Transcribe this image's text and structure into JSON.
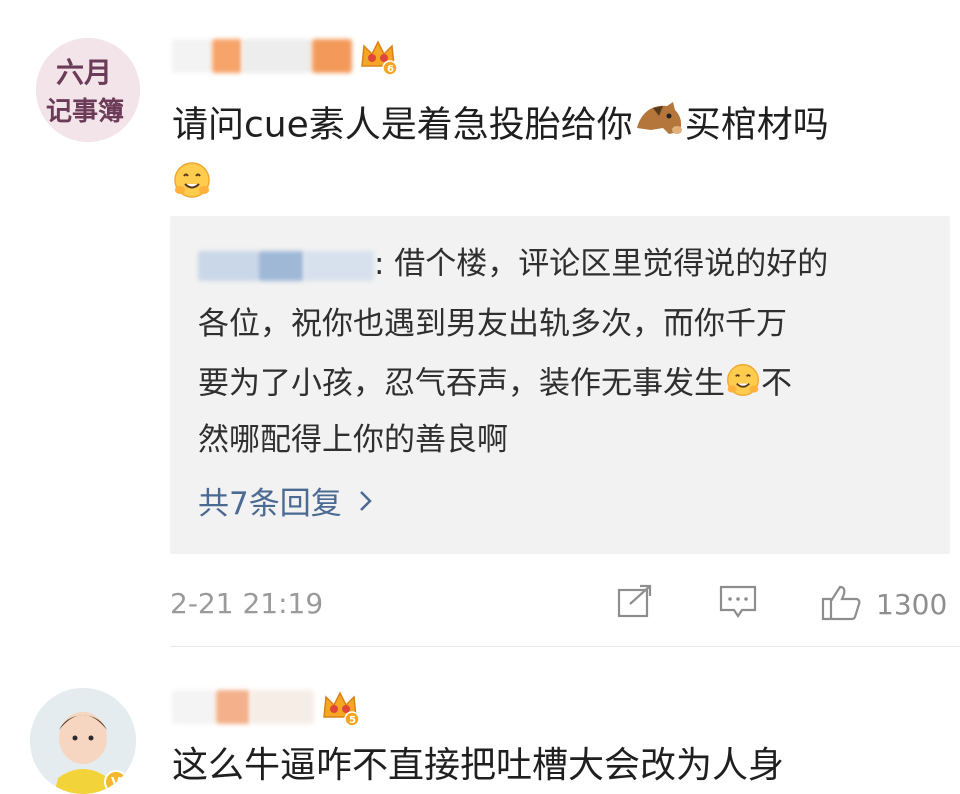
{
  "comment1": {
    "avatar_text": [
      "六月",
      "记事簿"
    ],
    "badge_level": "6",
    "text_line1": "请问cue素人是着急投胎给你",
    "text_line1_tail": "买棺材吗",
    "emoji_horse": "horse-face",
    "emoji_smile": "hugging-face",
    "quote": {
      "line1_tail": ": 借个楼，评论区里觉得说的好的",
      "line2": "各位，祝你也遇到男友出轨多次，而你千万",
      "line3": "要为了小孩，忍气吞声，装作无事发生",
      "line3_tail": "不",
      "line4": "然哪配得上你的善良啊",
      "more": "共7条回复",
      "more_icon": "chevron-right-icon"
    },
    "time": "2-21 21:19",
    "like_count": "1300"
  },
  "comment2": {
    "badge_level": "5",
    "text_partial": "这么牛逼咋不直接把吐槽大会改为人身"
  },
  "colors": {
    "link": "#4b6a93",
    "quote_bg": "#f2f2f2",
    "meta": "#9a9a9a",
    "crown": "#f5a623"
  }
}
